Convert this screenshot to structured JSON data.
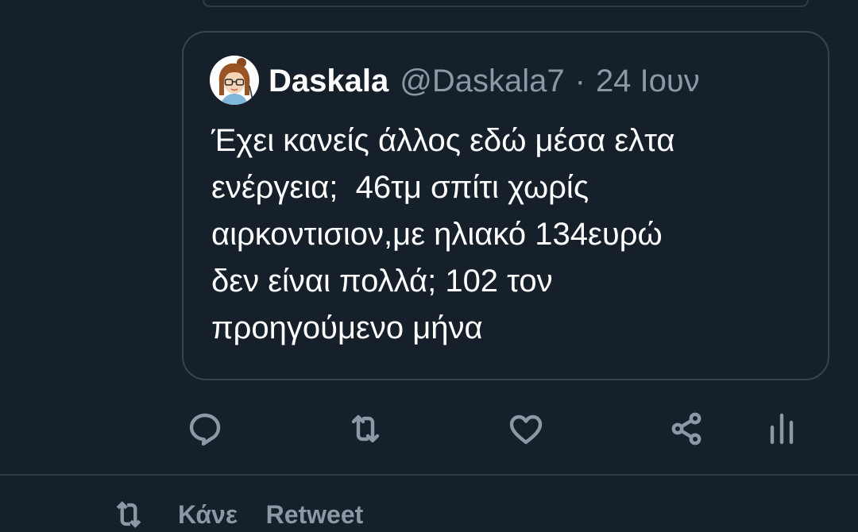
{
  "quoted_tweet": {
    "display_name": "Daskala",
    "handle": "@Daskala7",
    "separator": "·",
    "date": "24 Ιουν",
    "text": "Έχει κανείς άλλος εδώ μέσα ελτα\nενέργεια;  46τμ σπίτι χωρίς\nαιρκοντισιον,με ηλιακό 134ευρώ\nδεν είναι πολλά; 102 τον\nπροηγούμενο μήνα"
  },
  "actions": [
    {
      "name": "reply",
      "icon": "reply-icon"
    },
    {
      "name": "retweet",
      "icon": "retweet-icon"
    },
    {
      "name": "like",
      "icon": "heart-icon"
    },
    {
      "name": "share",
      "icon": "share-icon"
    },
    {
      "name": "analytics",
      "icon": "analytics-icon"
    }
  ],
  "bottom_row": {
    "text": "Κάνε    Retweet"
  },
  "colors": {
    "background": "#15202b",
    "border": "#38444d",
    "text_primary": "#ffffff",
    "text_secondary": "#8b98a5"
  }
}
